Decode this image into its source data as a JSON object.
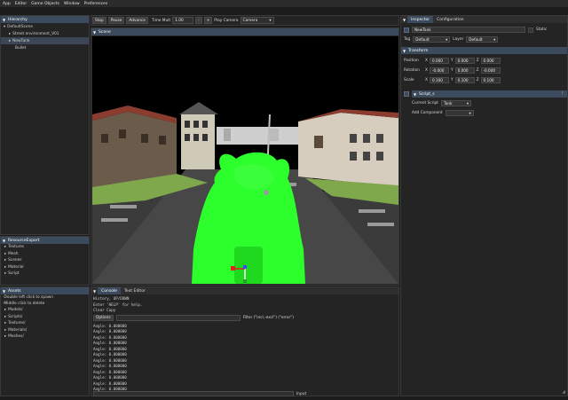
{
  "menu": [
    "App",
    "Editor",
    "Game Objects",
    "Window",
    "Preferences"
  ],
  "hierarchy": {
    "title": "Hierarchy",
    "items": [
      "DefaultScene",
      "Street environment_V01",
      "NewTank",
      "Bullet"
    ]
  },
  "toolbar": {
    "play": "Stop",
    "pause": "Pause",
    "advance": "Advance",
    "time_mult_label": "Time Mult",
    "time_mult_value": "1.00",
    "minus": "-",
    "plus": "+",
    "play_camera_label": "Play Camera",
    "play_camera_value": "Camera"
  },
  "scene": {
    "title": "Scene"
  },
  "resources": {
    "title": "ResourceExport",
    "items": [
      "Textures",
      "Mesh",
      "Scenes",
      "Material",
      "Script"
    ]
  },
  "assets": {
    "title": "Assets",
    "hints": [
      "-Double left click to spawn",
      "-Middle click to delete"
    ],
    "items": [
      "Models/",
      "Scripts/",
      "Textures/",
      "Materials/",
      "Meshes/"
    ]
  },
  "console": {
    "tab_console": "Console",
    "tab_text_editor": "Text Editor",
    "history_lines": [
      "History, UP/DOWN",
      "Enter 'HELP' for help.",
      "Clear  Copy"
    ],
    "options_label": "Options",
    "filter_label": "Filter (\"incl,-excl\") (\"error\")",
    "log_lines": [
      "Angle: 0.000000",
      "Angle: 0.000000",
      "Angle: 0.000000",
      "Angle: 0.000000",
      "Angle: 0.000000",
      "Angle: 0.000000",
      "Angle: 0.000000",
      "Angle: 0.000000",
      "Angle: 0.000000",
      "Angle: 0.000000",
      "Angle: 0.000000",
      "Angle: 0.000000"
    ],
    "input_label": "Input"
  },
  "inspector": {
    "tab_inspector": "Inspector",
    "tab_configuration": "Configuration",
    "object_name": "NewTank",
    "static_label": "Static",
    "tag_label": "Tag",
    "tag_value": "Default",
    "layer_label": "Layer",
    "layer_value": "Default",
    "transform_title": "Transform",
    "position_label": "Position",
    "position": {
      "x": "0.000",
      "y": "0.000",
      "z": "0.000"
    },
    "rotation_label": "Rotation",
    "rotation": {
      "x": "-0.000",
      "y": "0.000",
      "z": "-0.000"
    },
    "scale_label": "Scale",
    "scale": {
      "x": "0.100",
      "y": "0.100",
      "z": "0.100"
    },
    "script_title": "Script_s",
    "current_script_label": "Current Script",
    "current_script_value": "Tank",
    "add_component_label": "Add Component"
  },
  "colors": {
    "title_bar": "#3b4a5c",
    "selection": "#3c4656",
    "tank_green": "#2cff2c",
    "panel_bg": "#242424"
  }
}
